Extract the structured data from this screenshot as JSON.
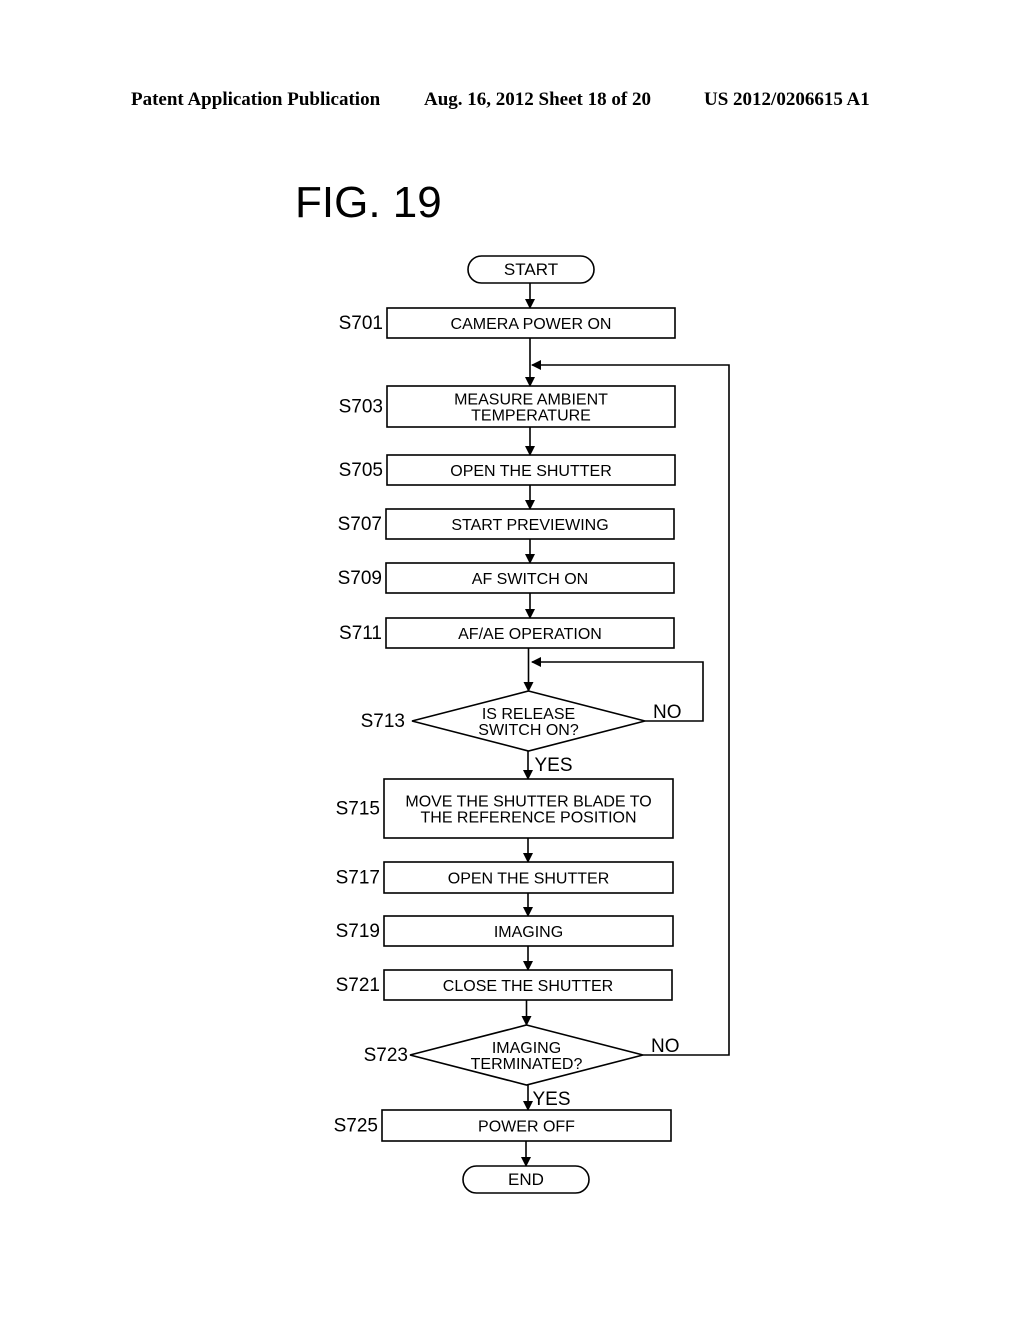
{
  "header": {
    "left": "Patent Application Publication",
    "middle": "Aug. 16, 2012  Sheet 18 of 20",
    "right": "US 2012/0206615 A1"
  },
  "figure_title": "FIG. 19",
  "flow": {
    "start": "START",
    "end": "END",
    "steps": [
      {
        "id": "S701",
        "lines": [
          "CAMERA POWER ON"
        ]
      },
      {
        "id": "S703",
        "lines": [
          "MEASURE AMBIENT",
          "TEMPERATURE"
        ]
      },
      {
        "id": "S705",
        "lines": [
          "OPEN THE SHUTTER"
        ]
      },
      {
        "id": "S707",
        "lines": [
          "START PREVIEWING"
        ]
      },
      {
        "id": "S709",
        "lines": [
          "AF SWITCH ON"
        ]
      },
      {
        "id": "S711",
        "lines": [
          "AF/AE OPERATION"
        ]
      },
      {
        "id": "S713",
        "type": "decision",
        "lines": [
          "IS RELEASE",
          "SWITCH ON?"
        ],
        "yes": "YES",
        "no": "NO"
      },
      {
        "id": "S715",
        "lines": [
          "MOVE THE SHUTTER BLADE TO",
          "THE REFERENCE POSITION"
        ]
      },
      {
        "id": "S717",
        "lines": [
          "OPEN THE SHUTTER"
        ]
      },
      {
        "id": "S719",
        "lines": [
          "IMAGING"
        ]
      },
      {
        "id": "S721",
        "lines": [
          "CLOSE THE SHUTTER"
        ]
      },
      {
        "id": "S723",
        "type": "decision",
        "lines": [
          "IMAGING",
          "TERMINATED?"
        ],
        "yes": "YES",
        "no": "NO"
      },
      {
        "id": "S725",
        "lines": [
          "POWER OFF"
        ]
      }
    ]
  }
}
